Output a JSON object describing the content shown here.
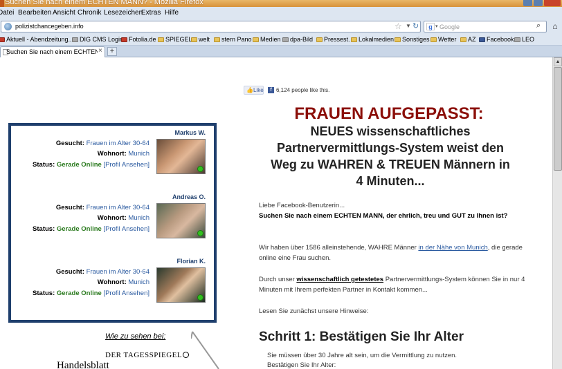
{
  "browser": {
    "title": "Suchen Sie nach einem ECHTEN MANN? - Mozilla Firefox",
    "menu": [
      "Datei",
      "Bearbeiten",
      "Ansicht",
      "Chronik",
      "Lesezeichen",
      "Extras",
      "Hilfe"
    ],
    "url": "polizistchancegeben.info",
    "search_placeholder": "Google",
    "bookmarks": [
      "Aktuell - Abendzeitung...",
      "DIG CMS Login",
      "Fotolia.de",
      "SPIEGEL",
      "welt",
      "stern Pano",
      "Medien",
      "dpa-Bild",
      "Pressest.",
      "Lokalmedien",
      "Sonstiges",
      "Wetter",
      "AZ",
      "Facebook",
      "LEO"
    ],
    "tab_label": "Suchen Sie nach einem ECHTEN MA...",
    "new_tab": "+"
  },
  "profiles": [
    {
      "name": "Markus W.",
      "gesucht_label": "Gesucht:",
      "gesucht": "Frauen im Alter 30-64",
      "wohnort_label": "Wohnort:",
      "wohnort": "Munich",
      "status_label": "Status:",
      "status": "Gerade Online",
      "link": "[Profil Ansehen]"
    },
    {
      "name": "Andreas O.",
      "gesucht_label": "Gesucht:",
      "gesucht": "Frauen im Alter 30-64",
      "wohnort_label": "Wohnort:",
      "wohnort": "Munich",
      "status_label": "Status:",
      "status": "Gerade Online",
      "link": "[Profil Ansehen]"
    },
    {
      "name": "Florian K.",
      "gesucht_label": "Gesucht:",
      "gesucht": "Frauen im Alter 30-64",
      "wohnort_label": "Wohnort:",
      "wohnort": "Munich",
      "status_label": "Status:",
      "status": "Gerade Online",
      "link": "[Profil Ansehen]"
    }
  ],
  "press": {
    "label": "Wie zu sehen bei:",
    "logo1": "DER TAGESSPIEGEL",
    "logo2": "Handelsblatt"
  },
  "facebook": {
    "like": "Like",
    "count": "6,124 people like this."
  },
  "headline": {
    "red": "FRAUEN AUFGEPASST:",
    "line1": "NEUES wissenschaftliches",
    "line2": "Partnervermittlungs-System weist den",
    "line3": "Weg zu WAHREN & TREUEN Männern in",
    "line4": "4 Minuten..."
  },
  "body": {
    "greeting": "Liebe Facebook-Benutzerin...",
    "question": "Suchen Sie nach einem ECHTEN MANN, der ehrlich, treu und GUT zu Ihnen ist?",
    "p2_a": "Wir haben über 1586 alleinstehende, WAHRE Männer ",
    "p2_link": "in der Nähe von Munich",
    "p2_b": ", die gerade online eine Frau suchen.",
    "p3_a": "Durch unser ",
    "p3_und": "wissenschaftlich getestetes",
    "p3_b": " Partnervermittlungs-System können Sie in nur 4 Minuten mit Ihrem perfekten Partner in Kontakt kommen...",
    "p4": "Lesen Sie zunächst unsere Hinweise:"
  },
  "step1": {
    "heading": "Schritt 1: Bestätigen Sie Ihr Alter",
    "line1": "Sie müssen über 30 Jahre alt sein, um die Vermittlung zu nutzen.",
    "line2": "Bestätigen Sie Ihr Alter:"
  }
}
